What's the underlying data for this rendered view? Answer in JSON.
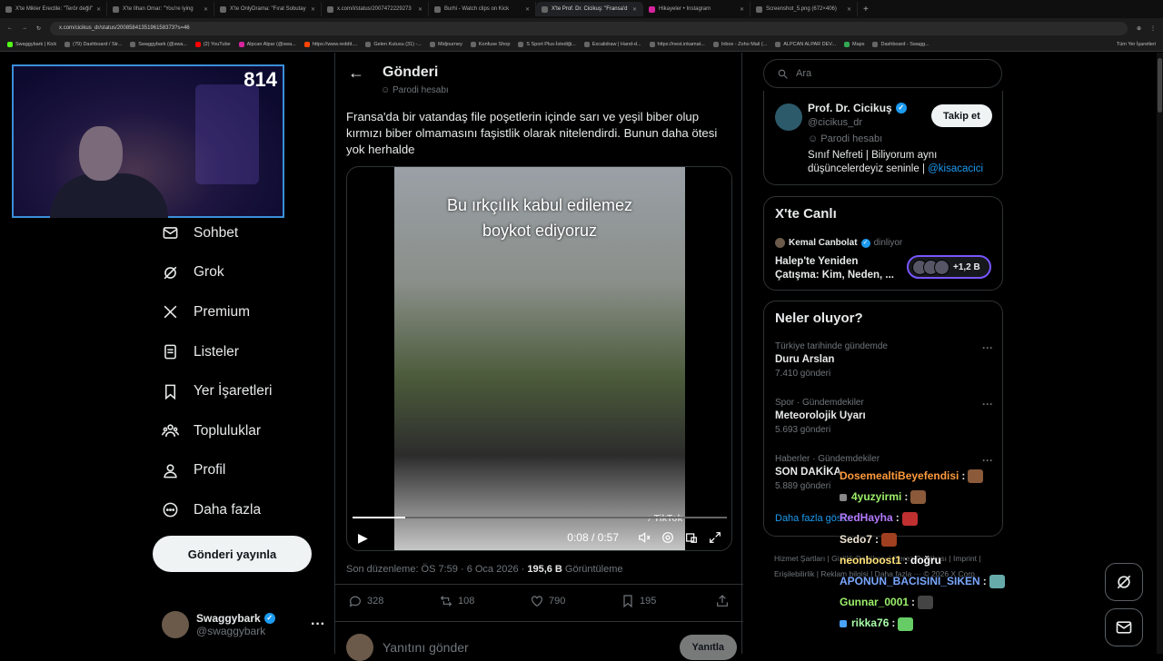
{
  "browser": {
    "tabs": [
      {
        "title": "X'te Mikler Erectile: \"Terör değil\""
      },
      {
        "title": "X'te Ilhan Omar: \"You're lying"
      },
      {
        "title": "X'te OnlyDrama: \"Fırat Sobutay"
      },
      {
        "title": "x.com/i/status/2007472229273"
      },
      {
        "title": "Burhi - Watch clips on Kick"
      },
      {
        "title": "X'te Prof. Dr. Cicikuş: \"Fransa'd"
      },
      {
        "title": "Hikayeler • Instagram"
      },
      {
        "title": "Screenshot_5.png (672×406)"
      }
    ],
    "url": "x.com/cicikus_dr/status/2008584135196158373?s=46",
    "bookmarks": [
      "Swaggybark | Kick",
      "(79) Dashboard / Str...",
      "Swaggybark (@swa...",
      "(2) YouTube",
      "Alpcan Alpar (@swa...",
      "https://www.reddit....",
      "Gelen Kutusu (31) -...",
      "Midjourney",
      "Konfuse Shop",
      "S Sport Plus-İstediği...",
      "Excalidraw | Hand-d...",
      "https://nest.inkamat...",
      "Inbox - Zoho Mail (...",
      "ALPCAN ALPAR DEV...",
      "Maps",
      "Dashboard - Swagg..."
    ],
    "bookmarks_all": "Tüm Yer İşaretleri"
  },
  "webcam": {
    "counter": "814"
  },
  "nav": {
    "items": [
      {
        "label": "Sohbet",
        "icon": "mail-icon"
      },
      {
        "label": "Grok",
        "icon": "grok-icon"
      },
      {
        "label": "Premium",
        "icon": "x-logo-icon"
      },
      {
        "label": "Listeler",
        "icon": "list-icon"
      },
      {
        "label": "Yer İşaretleri",
        "icon": "bookmark-icon"
      },
      {
        "label": "Topluluklar",
        "icon": "communities-icon"
      },
      {
        "label": "Profil",
        "icon": "profile-icon"
      },
      {
        "label": "Daha fazla",
        "icon": "more-circle-icon"
      }
    ],
    "post_button": "Gönderi yayınla"
  },
  "account": {
    "name": "Swaggybark",
    "handle": "@swaggybark"
  },
  "post": {
    "header": "Gönderi",
    "parody_label": "Parodi hesabı",
    "text": "Fransa'da bir vatandaş file poşetlerin içinde sarı ve yeşil biber olup kırmızı biber olmamasını faşistlik olarak nitelendirdi. Bunun daha ötesi yok herhalde",
    "video": {
      "caption_line1": "Bu ırkçılık kabul edilemez",
      "caption_line2": "boykot ediyoruz",
      "watermark": "TikTok",
      "time": "0:08 / 0:57",
      "progress": 0.14
    },
    "edited": "Son düzenleme: ÖS 7:59 · 6 Oca 2026 · ",
    "views": "195,6 B",
    "views_label": " Görüntüleme",
    "stats": {
      "replies": "328",
      "reposts": "108",
      "likes": "790",
      "bookmarks": "195"
    },
    "reply_placeholder": "Yanıtını gönder",
    "reply_button": "Yanıtla"
  },
  "sidebar": {
    "search_placeholder": "Ara",
    "profile": {
      "name": "Prof. Dr. Cicikuş",
      "handle": "@cicikus_dr",
      "parody": "Parodi hesabı",
      "bio": "Sınıf Nefreti | Biliyorum aynı düşüncelerdeyiz seninle | ",
      "bio_link": "@kisacacici",
      "follow": "Takip et"
    },
    "live": {
      "title": "X'te Canlı",
      "host": "Kemal Canbolat",
      "host_status": "dinliyor",
      "topic": "Halep'te Yeniden Çatışma: Kim, Neden, ...",
      "listeners": "+1,2 B"
    },
    "trends": {
      "title": "Neler oluyor?",
      "items": [
        {
          "context": "Türkiye tarihinde gündemde",
          "title": "Duru Arslan",
          "count": "7.410 gönderi"
        },
        {
          "context": "Spor · Gündemdekiler",
          "title": "Meteorolojik Uyarı",
          "count": "5.693 gönderi"
        },
        {
          "context": "Haberler · Gündemdekiler",
          "title": "SON DAKİKA",
          "count": "5.889 gönderi"
        }
      ],
      "show_more": "Daha fazla göster"
    },
    "footer": "Hizmet Şartları | Gizlilik Politikası | Çerez Politikası | Imprint | Erişilebilirlik | Reklam bilgisi | Daha fazla ··· © 2026 X Corp."
  },
  "chat": [
    {
      "user": "DosemealtiBeyefendisi",
      "color": "#ff9a3c"
    },
    {
      "user": "4yuzyirmi",
      "color": "#9cf06a"
    },
    {
      "user": "RedHayha",
      "color": "#b57bff"
    },
    {
      "user": "Sedo7",
      "color": "#f0e6d2"
    },
    {
      "user": "neonboost1",
      "color": "#ffe27a",
      "message": "doğru"
    },
    {
      "user": "APONUN_BACISINI_SIKEN",
      "color": "#7aa8ff"
    },
    {
      "user": "Gunnar_0001",
      "color": "#9cf06a"
    },
    {
      "user": "rikka76",
      "color": "#a8ffa8"
    }
  ]
}
